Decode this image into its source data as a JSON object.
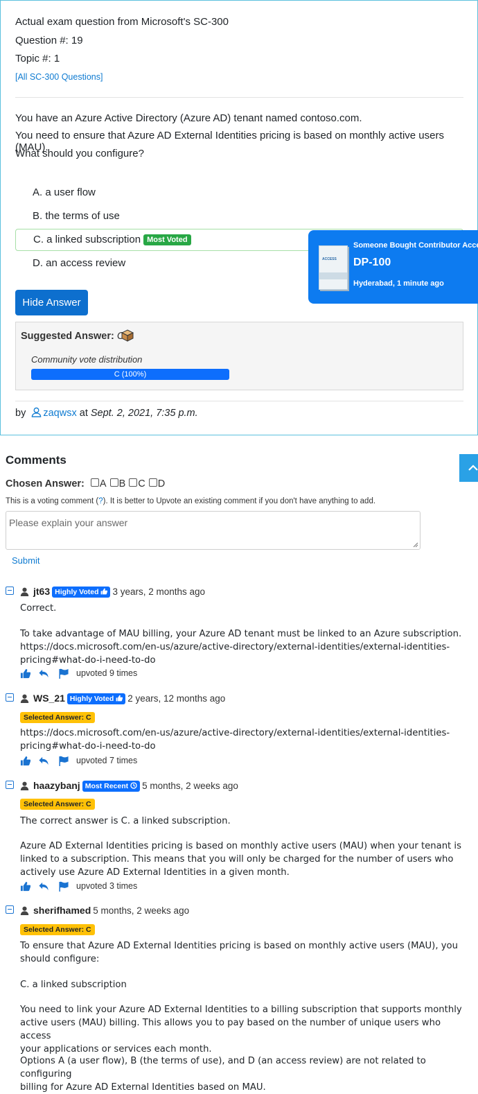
{
  "question": {
    "header": "Actual exam question from Microsoft's SC-300",
    "number": "Question #: 19",
    "topic": "Topic #: 1",
    "all_link": "[All SC-300 Questions]",
    "lines": [
      "You have an Azure Active Directory (Azure AD) tenant named contoso.com.",
      "You need to ensure that Azure AD External Identities pricing is based on monthly active users (MAU).",
      "What should you configure?"
    ],
    "choices": [
      {
        "text": "A. a user flow"
      },
      {
        "text": "B. the terms of use"
      },
      {
        "text": "C. a linked subscription",
        "badge": "Most Voted"
      },
      {
        "text": "D. an access review"
      }
    ],
    "hide_button": "Hide Answer",
    "suggested_label": "Suggested Answer:",
    "suggested_value": "C",
    "vote_label": "Community vote distribution",
    "vote_bar": "C (100%)",
    "vote_share": 1.0,
    "by": "by",
    "author": "zaqwsx",
    "at": "at",
    "date": "Sept. 2, 2021, 7:35 p.m."
  },
  "toast": {
    "line1": "Someone Bought Contributor Access for",
    "line2": "DP-100",
    "line3": "Hyderabad, 1 minute ago",
    "product_lettering": "ACCESS"
  },
  "comments_section": {
    "title": "Comments",
    "chosen_label": "Chosen Answer:",
    "options": [
      "A",
      "B",
      "C",
      "D"
    ],
    "note_before": "This is a voting comment (",
    "note_link": "?",
    "note_after": "). It is better to Upvote an existing comment if you don't have anything to add.",
    "placeholder": "Please explain your answer",
    "submit": "Submit"
  },
  "comments": [
    {
      "user": "jt63",
      "badge": "Highly Voted",
      "time": "3 years, 2 months ago",
      "paragraphs": [
        "Correct.",
        "To take advantage of MAU billing, your Azure AD tenant must be linked to an Azure subscription.\nhttps://docs.microsoft.com/en-us/azure/active-directory/external-identities/external-identities-\npricing#what-do-i-need-to-do"
      ],
      "upvotes": "upvoted 9 times"
    },
    {
      "user": "WS_21",
      "badge": "Highly Voted",
      "time": "2 years, 12 months ago",
      "selected": "Selected Answer: C",
      "paragraphs": [
        "https://docs.microsoft.com/en-us/azure/active-directory/external-identities/external-identities-\npricing#what-do-i-need-to-do"
      ],
      "upvotes": "upvoted 7 times"
    },
    {
      "user": "haazybanj",
      "badge": "Most Recent",
      "time": "5 months, 2 weeks ago",
      "selected": "Selected Answer: C",
      "paragraphs": [
        "The correct answer is C. a linked subscription.",
        "Azure AD External Identities pricing is based on monthly active users (MAU) when your tenant is\nlinked to a subscription. This means that you will only be charged for the number of users who\nactively use Azure AD External Identities in a given month."
      ],
      "upvotes": "upvoted 3 times"
    },
    {
      "user": "sherifhamed",
      "time": "5 months, 2 weeks ago",
      "selected": "Selected Answer: C",
      "paragraphs": [
        "To ensure that Azure AD External Identities pricing is based on monthly active users (MAU), you\nshould configure:",
        "C. a linked subscription",
        "You need to link your Azure AD External Identities to a billing subscription that supports monthly\nactive users (MAU) billing. This allows you to pay based on the number of unique users who access\nyour applications or services each month.",
        "Options A (a user flow), B (the terms of use), and D (an access review) are not related to configuring\nbilling for Azure AD External Identities based on MAU."
      ]
    }
  ]
}
